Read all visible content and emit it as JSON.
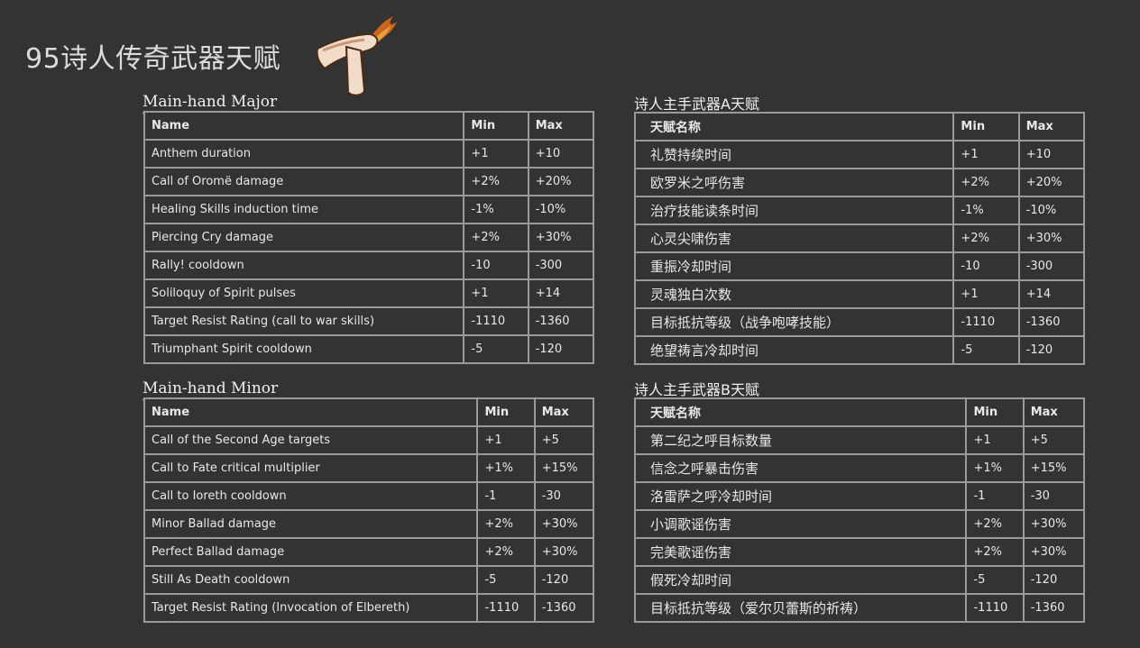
{
  "page_title": "95诗人传奇武器天赋",
  "logo_icon": "hammer-flame-icon",
  "colors": {
    "background": "#333333",
    "grid": "#9a9a9a",
    "text": "#e8e8e8"
  },
  "major_en": {
    "heading": "Main-hand Major",
    "columns": [
      "Name",
      "Min",
      "Max"
    ],
    "rows": [
      [
        "Anthem duration",
        "+1",
        "+10"
      ],
      [
        "Call of Oromë damage",
        "+2%",
        "+20%"
      ],
      [
        "Healing Skills induction time",
        "-1%",
        "-10%"
      ],
      [
        "Piercing Cry damage",
        "+2%",
        "+30%"
      ],
      [
        "Rally! cooldown",
        "-10",
        "-300"
      ],
      [
        "Soliloquy of Spirit pulses",
        "+1",
        "+14"
      ],
      [
        "Target Resist Rating (call to war skills)",
        "-1110",
        "-1360"
      ],
      [
        "Triumphant Spirit cooldown",
        "-5",
        "-120"
      ]
    ]
  },
  "minor_en": {
    "heading": "Main-hand Minor",
    "columns": [
      "Name",
      "Min",
      "Max"
    ],
    "rows": [
      [
        "Call of the Second Age targets",
        "+1",
        "+5"
      ],
      [
        "Call to Fate critical multiplier",
        "+1%",
        "+15%"
      ],
      [
        "Call to Ioreth cooldown",
        "-1",
        "-30"
      ],
      [
        "Minor Ballad damage",
        "+2%",
        "+30%"
      ],
      [
        "Perfect Ballad damage",
        "+2%",
        "+30%"
      ],
      [
        "Still As Death cooldown",
        "-5",
        "-120"
      ],
      [
        "Target Resist Rating (Invocation of Elbereth)",
        "-1110",
        "-1360"
      ]
    ]
  },
  "major_zh": {
    "heading": "诗人主手武器A天赋",
    "columns": [
      "天赋名称",
      "Min",
      "Max"
    ],
    "rows": [
      [
        "礼赞持续时间",
        "+1",
        "+10"
      ],
      [
        "欧罗米之呼伤害",
        "+2%",
        "+20%"
      ],
      [
        "治疗技能读条时间",
        "-1%",
        "-10%"
      ],
      [
        "心灵尖啸伤害",
        "+2%",
        "+30%"
      ],
      [
        "重振冷却时间",
        "-10",
        "-300"
      ],
      [
        "灵魂独白次数",
        "+1",
        "+14"
      ],
      [
        "目标抵抗等级（战争咆哮技能）",
        "-1110",
        "-1360"
      ],
      [
        "绝望祷言冷却时间",
        "-5",
        "-120"
      ]
    ]
  },
  "minor_zh": {
    "heading": "诗人主手武器B天赋",
    "columns": [
      "天赋名称",
      "Min",
      "Max"
    ],
    "rows": [
      [
        "第二纪之呼目标数量",
        "+1",
        "+5"
      ],
      [
        "信念之呼暴击伤害",
        "+1%",
        "+15%"
      ],
      [
        "洛雷萨之呼冷却时间",
        "-1",
        "-30"
      ],
      [
        "小调歌谣伤害",
        "+2%",
        "+30%"
      ],
      [
        "完美歌谣伤害",
        "+2%",
        "+30%"
      ],
      [
        "假死冷却时间",
        "-5",
        "-120"
      ],
      [
        "目标抵抗等级（爱尔贝蕾斯的祈祷）",
        "-1110",
        "-1360"
      ]
    ]
  }
}
